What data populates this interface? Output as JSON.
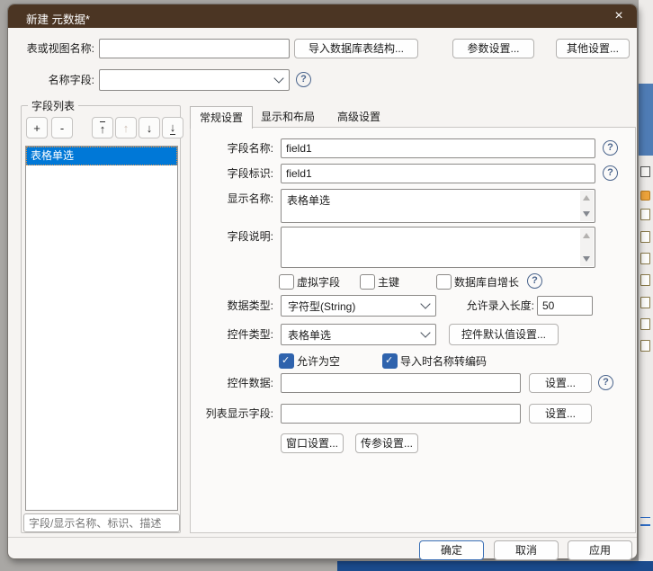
{
  "window": {
    "title": "新建 元数据*"
  },
  "icons": {
    "help": "?",
    "close": "×",
    "add": "+",
    "remove": "-",
    "up": "↑",
    "down": "↓"
  },
  "top": {
    "table_name_label": "表或视图名称:",
    "table_name_value": "",
    "import_structure_button": "导入数据库表结构...",
    "param_settings_button": "参数设置...",
    "other_settings_button": "其他设置...",
    "name_field_label": "名称字段:",
    "name_field_value": ""
  },
  "field_list": {
    "title": "字段列表",
    "items": [
      {
        "label": "表格单选",
        "selected": true
      }
    ],
    "search_placeholder": "字段/显示名称、标识、描述"
  },
  "tabs": [
    {
      "label": "常规设置",
      "active": true
    },
    {
      "label": "显示和布局",
      "active": false
    },
    {
      "label": "高级设置",
      "active": false
    }
  ],
  "form": {
    "field_name_label": "字段名称:",
    "field_name_value": "field1",
    "field_id_label": "字段标识:",
    "field_id_value": "field1",
    "display_name_label": "显示名称:",
    "display_name_value": "表格单选",
    "field_desc_label": "字段说明:",
    "field_desc_value": "",
    "flags": [
      {
        "label": "虚拟字段",
        "checked": false
      },
      {
        "label": "主键",
        "checked": false
      },
      {
        "label": "数据库自增长",
        "checked": false
      }
    ],
    "data_type_label": "数据类型:",
    "data_type_value": "字符型(String)",
    "input_length_label": "允许录入长度:",
    "input_length_value": "50",
    "control_type_label": "控件类型:",
    "control_type_value": "表格单选",
    "control_default_button": "控件默认值设置...",
    "options": [
      {
        "label": "允许为空",
        "checked": true
      },
      {
        "label": "导入时名称转编码",
        "checked": true
      }
    ],
    "control_data_label": "控件数据:",
    "control_data_value": "",
    "control_data_settings_button": "设置...",
    "list_display_label": "列表显示字段:",
    "list_display_value": "",
    "list_display_settings_button": "设置...",
    "window_settings_button": "窗口设置...",
    "param_pass_settings_button": "传参设置..."
  },
  "footer": {
    "ok": "确定",
    "cancel": "取消",
    "apply": "应用"
  },
  "colors": {
    "titlebar": "#4b3523",
    "selection": "#0078d7",
    "checkbox_on": "#2f63ad",
    "taskbar": "#1b4b8d",
    "backdrop_band": "#4f7cb5"
  }
}
